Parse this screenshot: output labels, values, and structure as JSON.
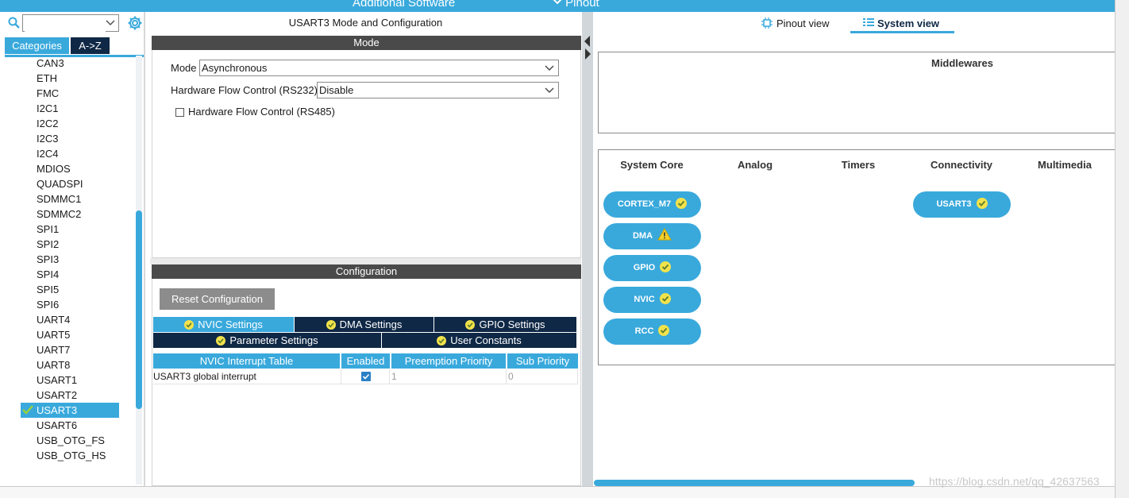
{
  "top_bar": {
    "additional_software": "Additional Software",
    "pinout": "Pinout"
  },
  "left": {
    "search": {
      "value": "",
      "placeholder": ""
    },
    "tabs": {
      "categories": "Categories",
      "az": "A->Z"
    },
    "items": [
      "CAN3",
      "ETH",
      "FMC",
      "I2C1",
      "I2C2",
      "I2C3",
      "I2C4",
      "MDIOS",
      "QUADSPI",
      "SDMMC1",
      "SDMMC2",
      "SPI1",
      "SPI2",
      "SPI3",
      "SPI4",
      "SPI5",
      "SPI6",
      "UART4",
      "UART5",
      "UART7",
      "UART8",
      "USART1",
      "USART2",
      "USART3",
      "USART6",
      "USB_OTG_FS",
      "USB_OTG_HS"
    ],
    "selected_item": "USART3"
  },
  "mid": {
    "title": "USART3 Mode and Configuration",
    "mode_header": "Mode",
    "mode": {
      "mode_label": "Mode",
      "mode_value": "Asynchronous",
      "hwfc232_label": "Hardware Flow Control (RS232)",
      "hwfc232_value": "Disable",
      "hwfc485_label": "Hardware Flow Control (RS485)"
    },
    "config_header": "Configuration",
    "reset_button": "Reset Configuration",
    "settings_tabs": {
      "nvic": "NVIC Settings",
      "dma": "DMA Settings",
      "gpio": "GPIO Settings",
      "parameter": "Parameter Settings",
      "user_constants": "User Constants"
    },
    "nvic_table": {
      "headers": {
        "name": "NVIC Interrupt Table",
        "enabled": "Enabled",
        "preemption": "Preemption Priority",
        "sub": "Sub Priority"
      },
      "row": {
        "name": "USART3 global interrupt",
        "preemption": "1",
        "sub": "0"
      }
    }
  },
  "right": {
    "tabs": {
      "pinout_view": "Pinout view",
      "system_view": "System view"
    },
    "middlewares": "Middlewares",
    "columns": {
      "system_core": "System Core",
      "analog": "Analog",
      "timers": "Timers",
      "connectivity": "Connectivity",
      "multimedia": "Multimedia"
    },
    "system_core_items": {
      "cortex": "CORTEX_M7",
      "dma": "DMA",
      "gpio": "GPIO",
      "nvic": "NVIC",
      "rcc": "RCC"
    },
    "connectivity_items": {
      "usart3": "USART3"
    }
  },
  "watermark": "https://blog.csdn.net/qq_42637563",
  "colors": {
    "accent": "#39a9dc",
    "navy": "#0f2846",
    "header_gray": "#4a4a4a",
    "ok_yellow": "#f2e24b",
    "warn_yellow": "#f5d22a"
  }
}
